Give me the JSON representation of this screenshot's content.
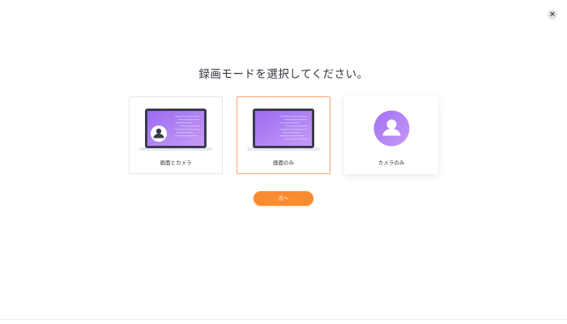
{
  "dialog": {
    "close_label": "×",
    "title": "録画モードを選択してください。"
  },
  "modes": [
    {
      "label": "画面とカメラ",
      "icon": "laptop-with-camera-icon",
      "state": "default"
    },
    {
      "label": "画面のみ",
      "icon": "laptop-icon",
      "state": "selected"
    },
    {
      "label": "カメラのみ",
      "icon": "camera-avatar-icon",
      "state": "hovered"
    }
  ],
  "next_button": {
    "label": "次へ"
  },
  "colors": {
    "accent": "#fb8b30",
    "selected_border": "#f6a274",
    "illustration_purple_start": "#9b6cf2",
    "illustration_purple_end": "#c08ef5",
    "laptop_frame": "#3a3a4e"
  }
}
